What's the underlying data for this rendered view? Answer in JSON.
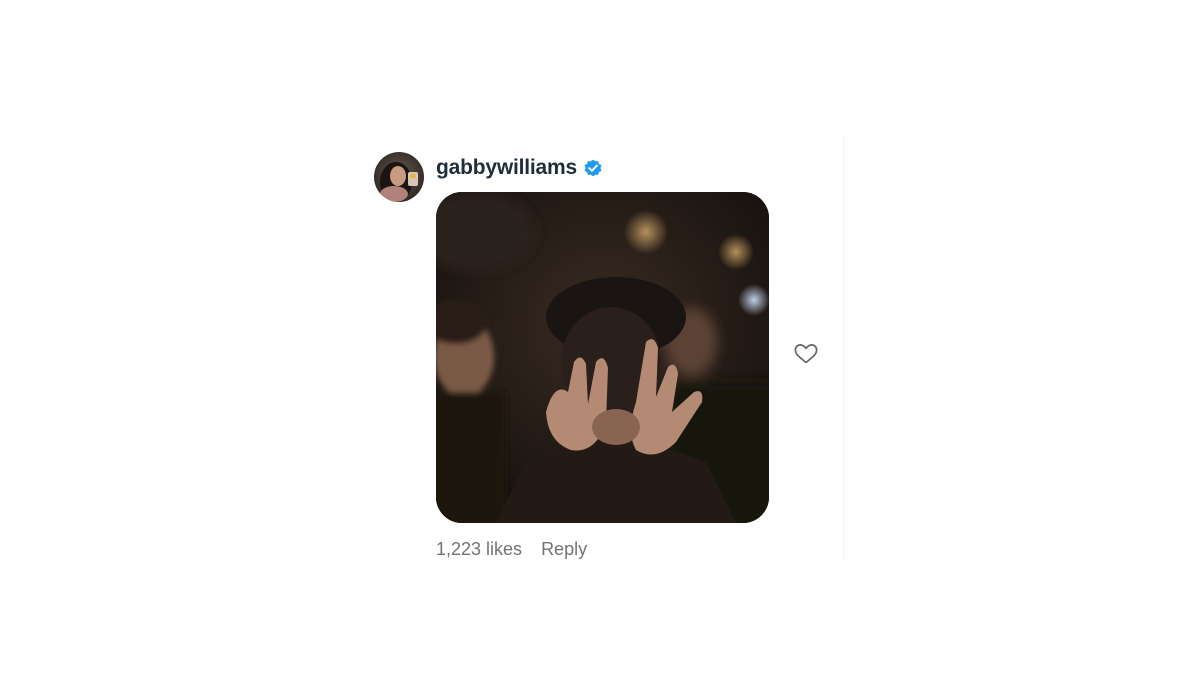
{
  "comment": {
    "username": "gabbywilliams",
    "verified": true,
    "avatar_icon": "profile-photo-avatar",
    "media_icon": "gif-image",
    "likes_text": "1,223 likes",
    "reply_label": "Reply",
    "like_icon": "heart-outline-icon"
  },
  "colors": {
    "username": "#1f2d3d",
    "verified_badge": "#1d9bf0",
    "meta_text": "#737373",
    "heart_stroke": "#666666"
  }
}
